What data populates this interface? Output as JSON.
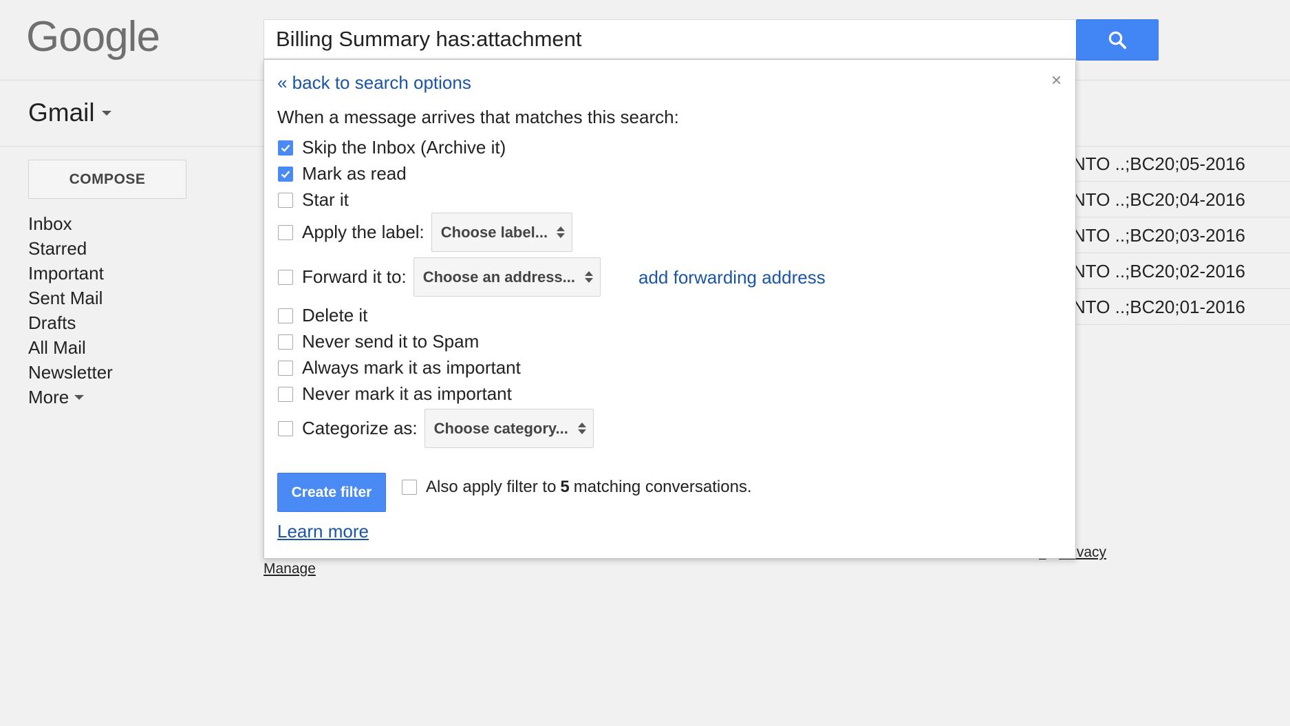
{
  "header": {
    "logo_text": "Google",
    "search_value": "Billing Summary has:attachment",
    "search_button_icon": "search-icon"
  },
  "app": {
    "name": "Gmail"
  },
  "sidebar": {
    "compose_label": "COMPOSE",
    "items": [
      {
        "label": "Inbox"
      },
      {
        "label": "Starred"
      },
      {
        "label": "Important"
      },
      {
        "label": "Sent Mail"
      },
      {
        "label": "Drafts"
      },
      {
        "label": "All Mail"
      },
      {
        "label": "Newsletter"
      },
      {
        "label": "More"
      }
    ]
  },
  "messages": [
    {
      "subject_tail": "NTO ..;BC20;05-2016"
    },
    {
      "subject_tail": "NTO ..;BC20;04-2016"
    },
    {
      "subject_tail": "NTO ..;BC20;03-2016"
    },
    {
      "subject_tail": "NTO ..;BC20;02-2016"
    },
    {
      "subject_tail": "NTO ..;BC20;01-2016"
    }
  ],
  "footer": {
    "manage": "Manage",
    "terms_partial": "s",
    "separator": "-",
    "privacy": "Privacy"
  },
  "filter": {
    "back_link": "« back to search options",
    "close": "×",
    "heading": "When a message arrives that matches this search:",
    "options": {
      "skip_inbox": {
        "label": "Skip the Inbox (Archive it)",
        "checked": true
      },
      "mark_read": {
        "label": "Mark as read",
        "checked": true
      },
      "star": {
        "label": "Star it",
        "checked": false
      },
      "apply_label": {
        "label": "Apply the label:",
        "checked": false,
        "select": "Choose label..."
      },
      "forward": {
        "label": "Forward it to:",
        "checked": false,
        "select": "Choose an address..."
      },
      "delete": {
        "label": "Delete it",
        "checked": false
      },
      "never_spam": {
        "label": "Never send it to Spam",
        "checked": false
      },
      "always_important": {
        "label": "Always mark it as important",
        "checked": false
      },
      "never_important": {
        "label": "Never mark it as important",
        "checked": false
      },
      "categorize": {
        "label": "Categorize as:",
        "checked": false,
        "select": "Choose category..."
      }
    },
    "add_forwarding": "add forwarding address",
    "create_button": "Create filter",
    "also_apply": {
      "prefix": "Also apply filter to",
      "count": "5",
      "suffix": "matching conversations.",
      "checked": false
    },
    "learn_more": "Learn more"
  },
  "colors": {
    "accent_blue": "#4285f4",
    "link_blue": "#1a55a6",
    "background": "#f1f1f1"
  }
}
